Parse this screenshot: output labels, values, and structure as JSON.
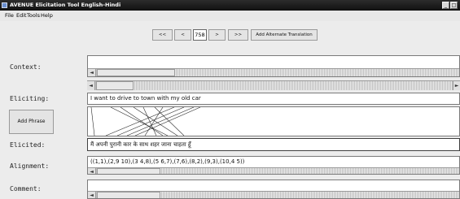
{
  "window": {
    "title": "AVENUE Elicitation Tool English-Hindi",
    "minimize_label": "_",
    "restore_label": "□"
  },
  "menu": {
    "items": [
      "File",
      "Edit",
      "Tools",
      "Help"
    ]
  },
  "toolbar": {
    "first_label": "<<",
    "prev_label": "<",
    "page_value": "758",
    "next_label": ">",
    "last_label": ">>",
    "alt_translation_label": "Add Alternate Translation"
  },
  "labels": {
    "context": "Context:",
    "eliciting": "Eliciting:",
    "elicited": "Elicited:",
    "alignment": "Alignment:",
    "comment": "Comment:"
  },
  "fields": {
    "eliciting_text": "I want to drive to town with my old car",
    "elicited_text": "मैं अपनी पुरानी कार के साथ शहर जाना चाहता हूँ",
    "alignment_text": "((1,1),(2,9 10),(3 4,8),(5 6,7),(7,6),(8,2),(9,3),(10,4 5))"
  },
  "buttons": {
    "add_phrase_label": "Add Phrase"
  },
  "scroll": {
    "arrow_left": "◄",
    "arrow_right": "►"
  }
}
